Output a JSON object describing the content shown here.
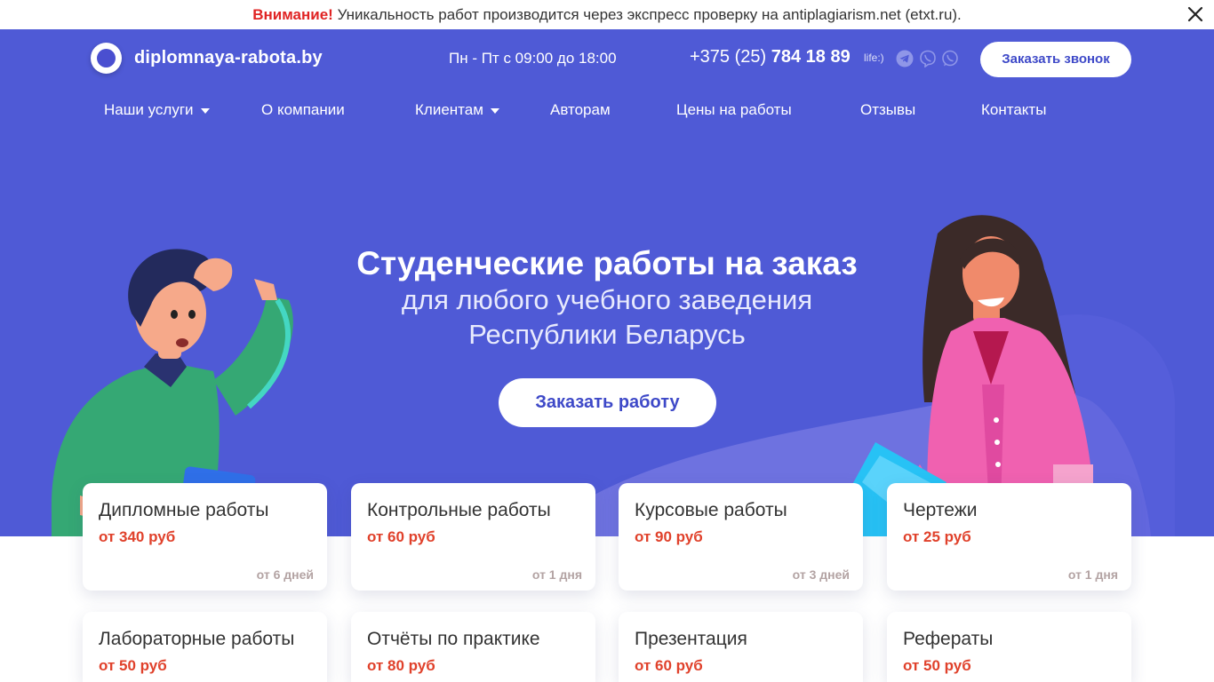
{
  "notice": {
    "warning": "Внимание!",
    "text": "Уникальность работ производится через экспресс проверку на antiplagiarism.net (etxt.ru)."
  },
  "header": {
    "logo_text": "diplomnaya-rabota.by",
    "hours": "Пн - Пт с 09:00 до 18:00",
    "phone_prefix": "+375 (25)",
    "phone_number": "784 18 89",
    "operator": "life:)",
    "messengers": [
      "telegram-icon",
      "viber-icon",
      "whatsapp-icon"
    ],
    "callback_label": "Заказать звонок"
  },
  "nav": [
    {
      "label": "Наши услуги",
      "dropdown": true
    },
    {
      "label": "О компании",
      "dropdown": false
    },
    {
      "label": "Клиентам",
      "dropdown": true
    },
    {
      "label": "Авторам",
      "dropdown": false
    },
    {
      "label": "Цены на работы",
      "dropdown": false
    },
    {
      "label": "Отзывы",
      "dropdown": false
    },
    {
      "label": "Контакты",
      "dropdown": false
    }
  ],
  "hero": {
    "title": "Студенческие работы на заказ",
    "subtitle_line1": "для любого учебного заведения",
    "subtitle_line2": "Республики Беларусь",
    "cta": "Заказать работу"
  },
  "services": [
    {
      "title": "Дипломные работы",
      "price": "от 340 руб",
      "duration": "от 6 дней"
    },
    {
      "title": "Контрольные работы",
      "price": "от 60 руб",
      "duration": "от 1 дня"
    },
    {
      "title": "Курсовые работы",
      "price": "от 90 руб",
      "duration": "от 3 дней"
    },
    {
      "title": "Чертежи",
      "price": "от 25 руб",
      "duration": "от 1 дня"
    },
    {
      "title": "Лабораторные работы",
      "price": "от 50 руб",
      "duration": ""
    },
    {
      "title": "Отчёты по практике",
      "price": "от 80 руб",
      "duration": ""
    },
    {
      "title": "Презентация",
      "price": "от 60 руб",
      "duration": ""
    },
    {
      "title": "Рефераты",
      "price": "от 50 руб",
      "duration": ""
    }
  ],
  "colors": {
    "hero_bg": "#4f5ad6",
    "accent": "#3e49c8",
    "price": "#e0412b",
    "warning": "#e02424"
  }
}
